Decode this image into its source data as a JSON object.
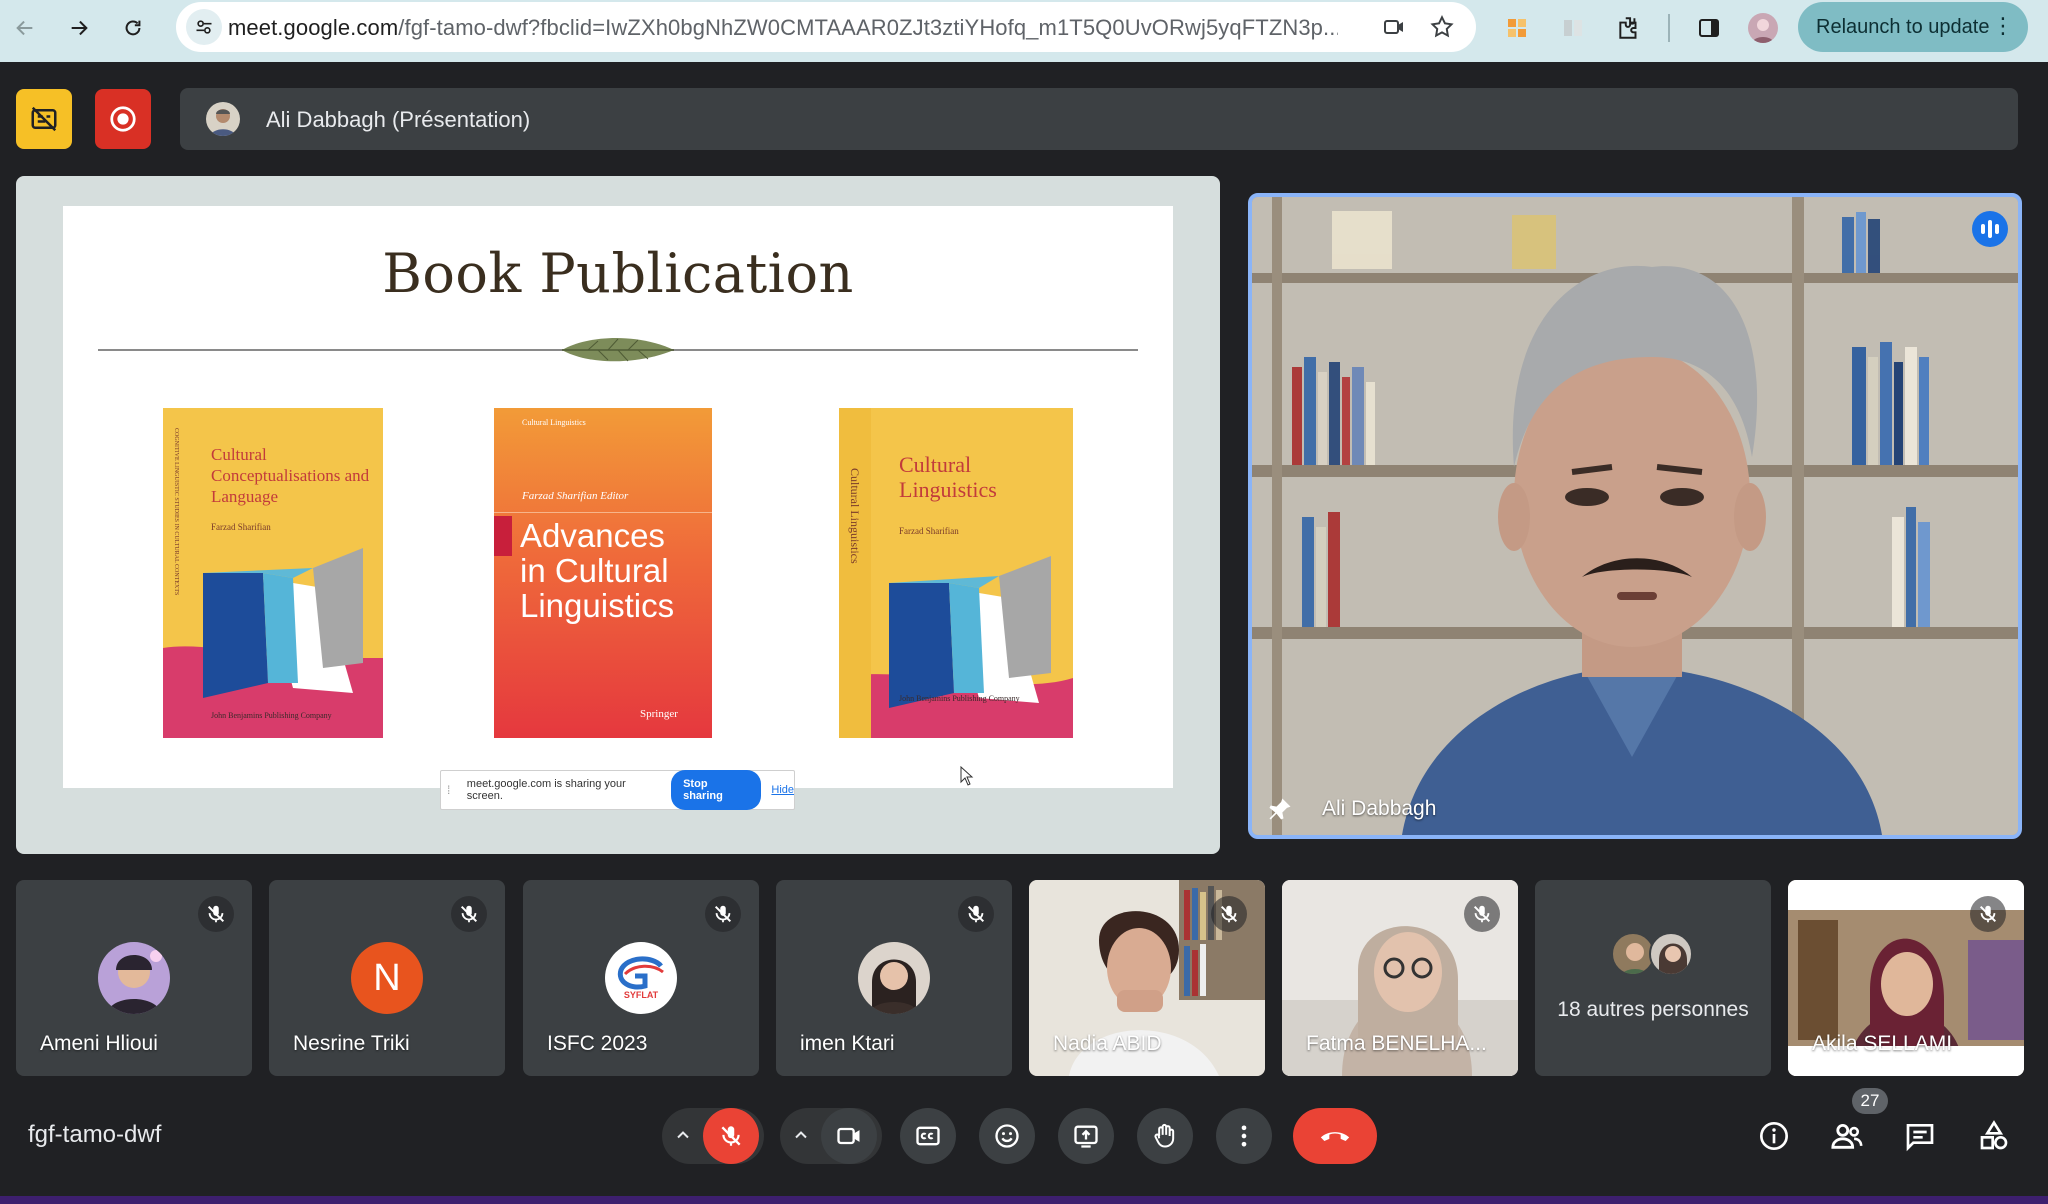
{
  "browser": {
    "url_host": "meet.google.com",
    "url_rest": "/fgf-tamo-dwf?fbclid=IwZXh0bgNhZW0CMTAAAR0ZJt3ztiYHofq_m1T5Q0UvORwj5yqFTZN3p...",
    "relaunch_label": "Relaunch to update"
  },
  "meeting": {
    "presenter_title": "Ali Dabbagh (Présentation)",
    "code": "fgf-tamo-dwf",
    "participant_count": "27"
  },
  "slide": {
    "title": "Book Publication",
    "books": [
      {
        "title": "Cultural Conceptualisations and Language",
        "author": "Farzad Sharifian",
        "publisher": "John Benjamins Publishing Company",
        "spine": "COGNITIVE LINGUISTIC STUDIES IN CULTURAL CONTEXTS"
      },
      {
        "series": "Cultural Linguistics",
        "editor": "Farzad Sharifian  Editor",
        "title": "Advances in Cultural Linguistics",
        "publisher": "Springer"
      },
      {
        "title": "Cultural Linguistics",
        "author": "Farzad Sharifian",
        "publisher": "John Benjamins Publishing Company",
        "spine": "Cultural Linguistics"
      }
    ]
  },
  "share_notice": {
    "message": "meet.google.com is sharing your screen.",
    "stop_label": "Stop sharing",
    "hide_label": "Hide"
  },
  "speaker": {
    "name": "Ali Dabbagh"
  },
  "participants": [
    {
      "name": "Ameni Hlioui"
    },
    {
      "name": "Nesrine Triki",
      "initial": "N"
    },
    {
      "name": "ISFC 2023",
      "logo_text": "SYFLAT"
    },
    {
      "name": "imen Ktari"
    },
    {
      "name": "Nadia ABID"
    },
    {
      "name": "Fatma BENELHA..."
    },
    {
      "name": "18 autres personnes"
    },
    {
      "name": "Akila SELLAMI"
    }
  ],
  "colors": {
    "accent": "#8ab4f8",
    "danger": "#ea4335",
    "record_yellow": "#f6c026",
    "record_red": "#d93025"
  }
}
